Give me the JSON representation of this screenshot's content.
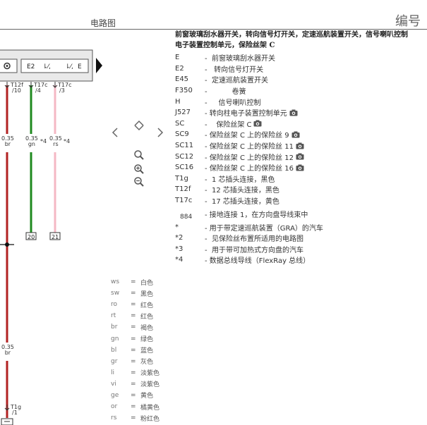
{
  "title": "电路图",
  "doc_label": "编号",
  "legend": {
    "heading1": "前窗玻璃刮水器开关，转向信号灯开关，定速巡航装置开关，信号喇叭控制",
    "heading2": "电子装置控制单元，保险丝架 C",
    "items": [
      {
        "code": "E",
        "desc": "-  前窗玻璃刮水器开关",
        "cam": false
      },
      {
        "code": "E2",
        "desc": "-   转向信号灯开关",
        "cam": false
      },
      {
        "code": "E45",
        "desc": "-  定速巡航装置开关",
        "cam": false
      },
      {
        "code": "F350",
        "desc": "-           卷簧",
        "cam": false
      },
      {
        "code": "H",
        "desc": "-     信号喇叭控制",
        "cam": false
      },
      {
        "code": "J527",
        "desc": "- 转向柱电子装置控制单元",
        "cam": true
      },
      {
        "code": "SC",
        "desc": "-    保险丝架 C",
        "cam": true
      },
      {
        "code": "SC9",
        "desc": "- 保险丝架 C 上的保险丝 9",
        "cam": true
      },
      {
        "code": "SC11",
        "desc": "- 保险丝架 C 上的保险丝 11",
        "cam": true
      },
      {
        "code": "SC12",
        "desc": "- 保险丝架 C 上的保险丝 12",
        "cam": true
      },
      {
        "code": "SC16",
        "desc": "- 保险丝架 C 上的保险丝 16",
        "cam": true
      },
      {
        "code": "T1g",
        "desc": "-  1 芯插头连接，黑色",
        "cam": false
      },
      {
        "code": "T12f",
        "desc": "-  12 芯插头连接，黑色",
        "cam": false
      },
      {
        "code": "T17c",
        "desc": "-  17 芯插头连接，黄色",
        "cam": false
      },
      {
        "code": "884",
        "desc": "- 接地连接 1，在方向盘导线束中",
        "cam": false
      },
      {
        "code": "*",
        "desc": "- 用于带定速巡航装置（GRA）的汽车",
        "cam": false
      },
      {
        "code": "*2",
        "desc": "-  见保险丝布置所适用的电路图",
        "cam": false
      },
      {
        "code": "*3",
        "desc": "-  用于带可加热式方向盘的汽车",
        "cam": false
      },
      {
        "code": "*4",
        "desc": "- 数据总线导线（FlexRay 总线）",
        "cam": false
      }
    ]
  },
  "colors": [
    {
      "code": "ws",
      "name": "白色"
    },
    {
      "code": "sw",
      "name": "黑色"
    },
    {
      "code": "ro",
      "name": "红色"
    },
    {
      "code": "rt",
      "name": "红色"
    },
    {
      "code": "br",
      "name": "褐色"
    },
    {
      "code": "gn",
      "name": "绿色"
    },
    {
      "code": "bl",
      "name": "蓝色"
    },
    {
      "code": "gr",
      "name": "灰色"
    },
    {
      "code": "li",
      "name": "淡紫色"
    },
    {
      "code": "vi",
      "name": "淡紫色"
    },
    {
      "code": "ge",
      "name": "黄色"
    },
    {
      "code": "or",
      "name": "橘黄色"
    },
    {
      "code": "rs",
      "name": "粉红色"
    }
  ],
  "diagram": {
    "component_label": "E2",
    "component_label2": "E",
    "connectors": [
      {
        "name": "T12f",
        "pin": "/10"
      },
      {
        "name": "T17c",
        "pin": "/4"
      },
      {
        "name": "T17c",
        "pin": "/3"
      },
      {
        "name": "T1g",
        "pin": "/1"
      }
    ],
    "wires": [
      {
        "size": "0.35",
        "color_code": "br",
        "mark": ""
      },
      {
        "size": "0.35",
        "color_code": "gn",
        "mark": "*4"
      },
      {
        "size": "0.35",
        "color_code": "rs",
        "mark": "*4"
      },
      {
        "size": "0.35",
        "color_code": "br",
        "mark": ""
      }
    ],
    "refs": [
      "20",
      "21"
    ],
    "wire_colors": {
      "br": "#b22222",
      "gn": "#1f8a1f",
      "rs": "#f4b8c4"
    }
  }
}
